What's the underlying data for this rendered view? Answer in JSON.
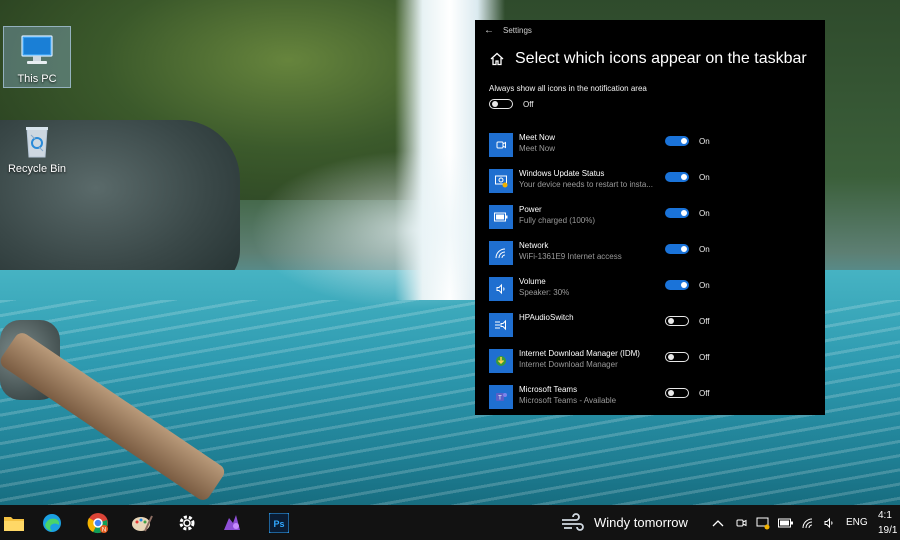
{
  "desktop": {
    "icons": [
      {
        "label": "This PC",
        "icon": "computer-icon"
      },
      {
        "label": "Recycle Bin",
        "icon": "recycle-bin-icon"
      }
    ]
  },
  "settings": {
    "window_title": "Settings",
    "heading": "Select which icons appear on the taskbar",
    "always_show": {
      "label": "Always show all icons in the notification area",
      "state": "Off"
    },
    "items": [
      {
        "name": "Meet Now",
        "sub": "Meet Now",
        "state": "On",
        "icon": "meet-now-icon"
      },
      {
        "name": "Windows Update Status",
        "sub": "Your device needs to restart to insta...",
        "state": "On",
        "icon": "windows-update-icon"
      },
      {
        "name": "Power",
        "sub": "Fully charged (100%)",
        "state": "On",
        "icon": "battery-icon"
      },
      {
        "name": "Network",
        "sub": "WiFi-1361E9 Internet access",
        "state": "On",
        "icon": "wifi-icon"
      },
      {
        "name": "Volume",
        "sub": "Speaker: 30%",
        "state": "On",
        "icon": "speaker-icon"
      },
      {
        "name": "HPAudioSwitch",
        "sub": "",
        "state": "Off",
        "icon": "audio-switch-icon"
      },
      {
        "name": "Internet Download Manager (IDM)",
        "sub": "Internet Download Manager",
        "state": "Off",
        "icon": "idm-icon"
      },
      {
        "name": "Microsoft Teams",
        "sub": "Microsoft Teams - Available",
        "state": "Off",
        "icon": "teams-icon"
      }
    ]
  },
  "taskbar": {
    "weather": "Windy tomorrow",
    "language": "ENG",
    "clock_time": "4:1",
    "clock_date": "19/1",
    "apps": [
      "file-explorer-icon",
      "edge-icon",
      "chrome-icon",
      "paint-icon",
      "settings-gear-icon",
      "app-icon",
      "photoshop-icon"
    ],
    "photoshop_label": "Ps",
    "chrome_badge": "N"
  },
  "colors": {
    "accent": "#1a73d9",
    "tile": "#1f6fd0",
    "window_bg": "#000000",
    "taskbar_bg": "#121212"
  }
}
